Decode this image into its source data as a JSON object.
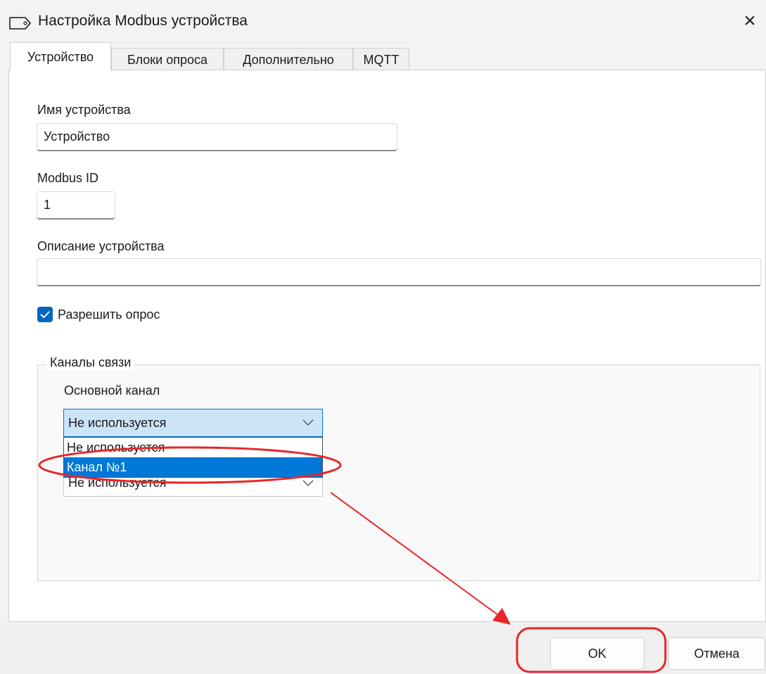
{
  "window": {
    "title": "Настройка Modbus устройства",
    "close_glyph": "×",
    "title_icon": "tag-icon"
  },
  "tabs": [
    {
      "label": "Устройство",
      "active": true
    },
    {
      "label": "Блоки опроса",
      "active": false
    },
    {
      "label": "Дополнительно",
      "active": false
    },
    {
      "label": "MQTT",
      "active": false
    }
  ],
  "device": {
    "name_label": "Имя устройства",
    "name_value": "Устройство",
    "modbus_id_label": "Modbus ID",
    "modbus_id_value": "1",
    "description_label": "Описание устройства",
    "description_value": "",
    "enable_polling_label": "Разрешить опрос",
    "enable_polling_checked": true
  },
  "channels": {
    "group_title": "Каналы связи",
    "main_label": "Основной канал",
    "main_selected": "Не используется",
    "dropdown_options": [
      "Не используется",
      "Канал №1"
    ],
    "dropdown_highlighted": "Канал №1",
    "secondary_selected": "Не используется"
  },
  "footer": {
    "ok_label": "OK",
    "cancel_label": "Отмена"
  },
  "colors": {
    "accent": "#0078d7",
    "annotation": "#e8262a"
  }
}
